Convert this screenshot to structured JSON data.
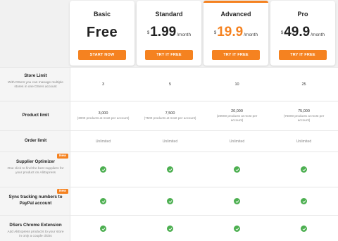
{
  "plans": [
    {
      "name": "Basic",
      "price_free": "Free",
      "button": "START NOW"
    },
    {
      "name": "Standard",
      "currency": "$",
      "price": "1.99",
      "period": "/month",
      "button": "TRY IT FREE"
    },
    {
      "name": "Advanced",
      "currency": "$",
      "price": "19.9",
      "period": "/month",
      "button": "TRY IT FREE"
    },
    {
      "name": "Pro",
      "currency": "$",
      "price": "49.9",
      "period": "/month",
      "button": "TRY IT FREE"
    }
  ],
  "features": [
    {
      "title": "Store Limit",
      "desc": "With DSers you can manage multiple stores in one DSers account",
      "values": [
        "3",
        "5",
        "10",
        "25"
      ]
    },
    {
      "title": "Product limit",
      "values": [
        {
          "main": "3,000",
          "sub": "(3000 products at most per account)"
        },
        {
          "main": "7,500",
          "sub": "(7500 products at most per account)"
        },
        {
          "main": "20,000",
          "sub": "(20000 products at most per account)"
        },
        {
          "main": "75,000",
          "sub": "(75000 products at most per account)"
        }
      ]
    },
    {
      "title": "Order limit",
      "values": [
        "Unlimited",
        "Unlimited",
        "Unlimited",
        "Unlimited"
      ]
    },
    {
      "title": "Supplier Optimizer",
      "badge": "New",
      "desc": "One click to find the best suppliers for your product on AliExpress"
    },
    {
      "title": "Sync tracking numbers to PayPal account",
      "badge": "New"
    },
    {
      "title": "DSers Chrome Extension",
      "desc": "Add AliExpress products to your store in only a couple clicks"
    }
  ],
  "colors": {
    "accent": "#f58220",
    "check": "#4caf50"
  }
}
